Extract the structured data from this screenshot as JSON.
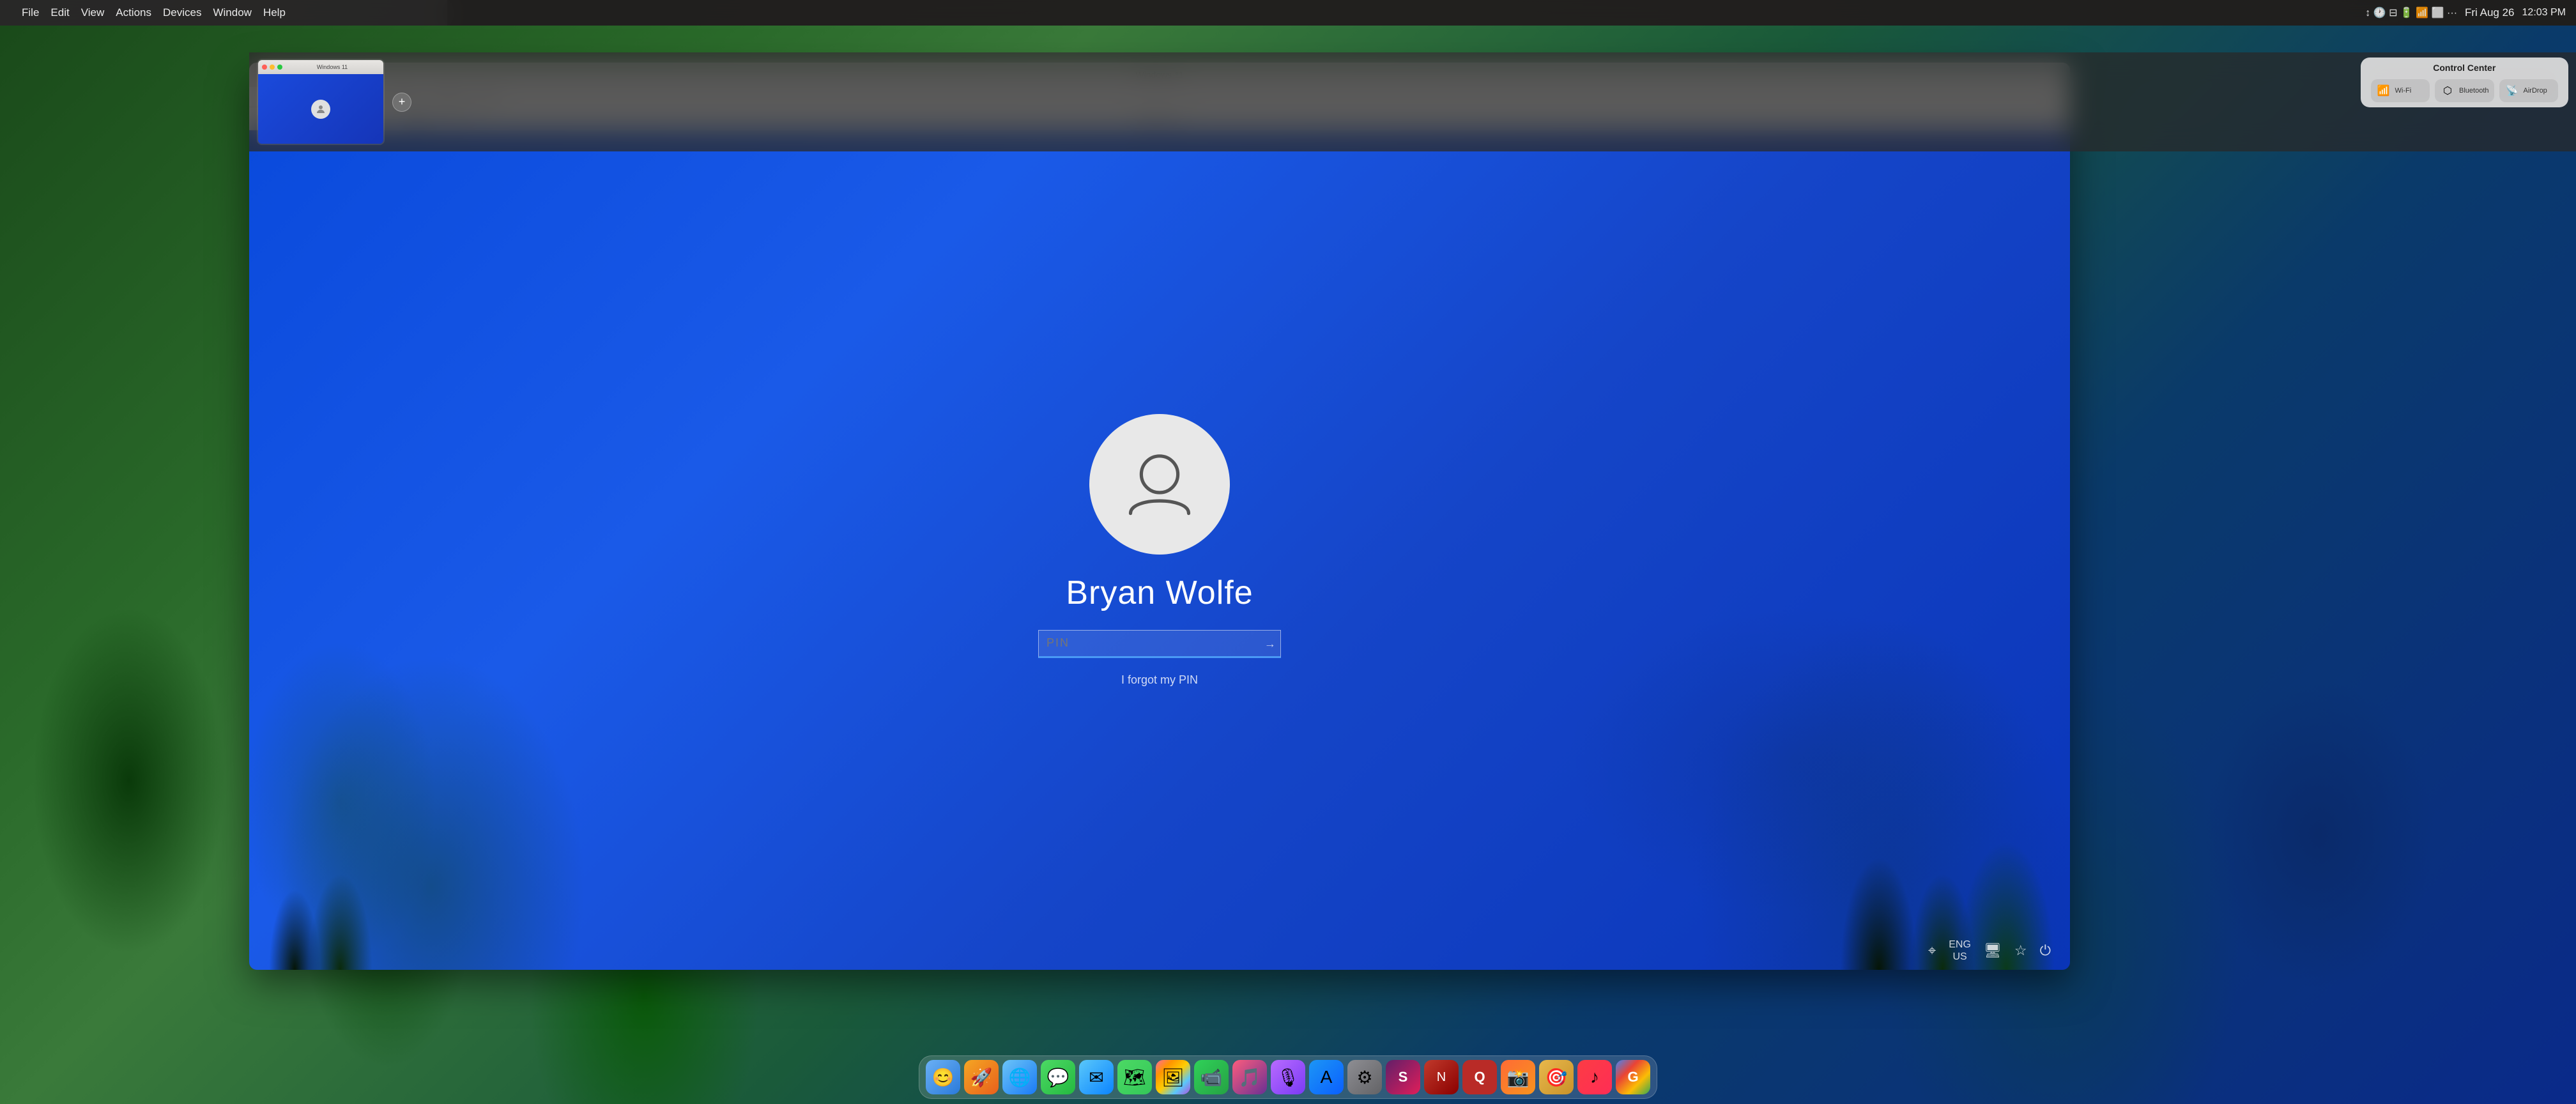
{
  "meta": {
    "title": "MacBook displaying Windows 11 VM login screen"
  },
  "macos": {
    "menubar": {
      "apple_symbol": "⌘",
      "menu_items": [
        "File",
        "Edit",
        "View",
        "Actions",
        "Devices",
        "Window",
        "Help"
      ],
      "right_icons": [
        "↕",
        "🕐",
        "⊟",
        "🔋",
        "📶",
        "⬜",
        "···",
        "📷",
        "Fri Aug 26",
        "12:03 PM"
      ]
    },
    "dock": {
      "items": [
        {
          "name": "Finder",
          "emoji": "🔍",
          "class": "di-finder"
        },
        {
          "name": "Launchpad",
          "emoji": "🚀",
          "class": "di-launchpad"
        },
        {
          "name": "Safari",
          "emoji": "🌐",
          "class": "di-safari"
        },
        {
          "name": "Messages",
          "emoji": "💬",
          "class": "di-messages"
        },
        {
          "name": "Mail",
          "emoji": "✉️",
          "class": "di-mail"
        },
        {
          "name": "Maps",
          "emoji": "🗺",
          "class": "di-maps"
        },
        {
          "name": "Photos",
          "emoji": "🖼",
          "class": "di-photos"
        },
        {
          "name": "FaceTime",
          "emoji": "📹",
          "class": "di-facetime"
        },
        {
          "name": "iTunes",
          "emoji": "🎵",
          "class": "di-itunes"
        },
        {
          "name": "Podcasts",
          "emoji": "🎙",
          "class": "di-podcasts"
        },
        {
          "name": "App Store",
          "emoji": "⊞",
          "class": "di-appstore"
        },
        {
          "name": "System Settings",
          "emoji": "⚙",
          "class": "di-settings"
        },
        {
          "name": "Slack",
          "emoji": "S",
          "class": "di-slack"
        },
        {
          "name": "News",
          "emoji": "N",
          "class": "di-news"
        },
        {
          "name": "Quora",
          "emoji": "Q",
          "class": "di-quora"
        },
        {
          "name": "Snagit",
          "emoji": "📸",
          "class": "di-snagit"
        },
        {
          "name": "Maps2",
          "emoji": "🗺",
          "class": "di-maps2"
        },
        {
          "name": "Music",
          "emoji": "♪",
          "class": "di-music"
        },
        {
          "name": "Google",
          "emoji": "G",
          "class": "di-google"
        }
      ]
    }
  },
  "virtualbox": {
    "window_title": "Windows 11",
    "menu_items": [
      "File",
      "Edit",
      "View",
      "Actions",
      "Devices",
      "Window",
      "Help"
    ],
    "toolbar_title": "Windows 11",
    "vm_title": "Windows 11"
  },
  "windows11": {
    "username": "Bryan Wolfe",
    "pin_placeholder": "PIN",
    "forgot_pin_text": "I forgot my PIN",
    "taskbar": {
      "language": "ENG\nUS",
      "icons": [
        "🖱",
        "🔧",
        "⏻"
      ]
    }
  },
  "thumb_strip": {
    "title": "Control Center",
    "card_title": "Windows 11",
    "plus_label": "+"
  }
}
